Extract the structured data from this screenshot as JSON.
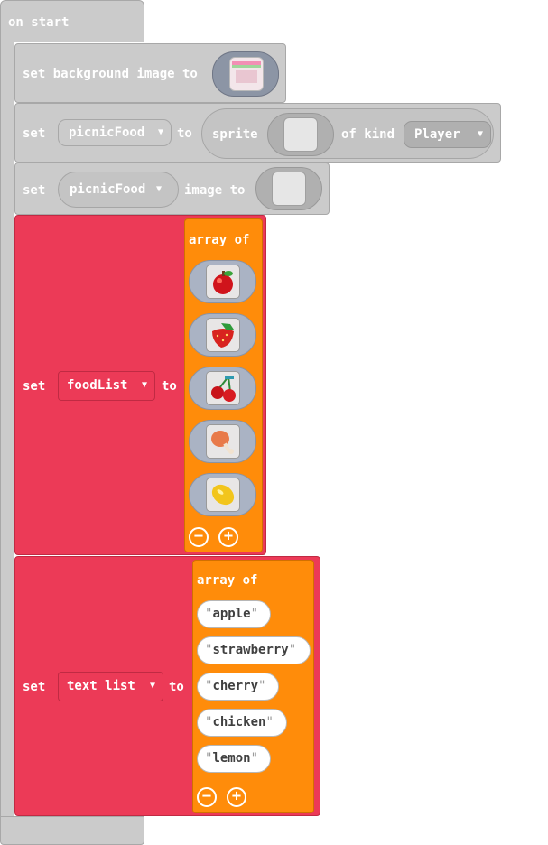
{
  "event": {
    "label": "on start"
  },
  "set_background": {
    "label": "set background image to"
  },
  "set_sprite": {
    "set": "set",
    "variable": "picnicFood",
    "to": "to",
    "sprite": "sprite",
    "of_kind": "of kind",
    "kind": "Player"
  },
  "set_image": {
    "set": "set",
    "variable": "picnicFood",
    "image_to": "image to"
  },
  "food_list": {
    "set": "set",
    "variable": "foodList",
    "to": "to",
    "array_of": "array of",
    "items": [
      {
        "icon": "apple-icon"
      },
      {
        "icon": "strawberry-icon"
      },
      {
        "icon": "cherry-icon"
      },
      {
        "icon": "chicken-icon"
      },
      {
        "icon": "lemon-icon"
      }
    ]
  },
  "text_list": {
    "set": "set",
    "variable": "text list",
    "to": "to",
    "array_of": "array of",
    "items": [
      "apple",
      "strawberry",
      "cherry",
      "chicken",
      "lemon"
    ]
  },
  "controls": {
    "remove": "−",
    "add": "+"
  },
  "colors": {
    "gray_block": "#cbcbcb",
    "variable_red": "#ec3a57",
    "array_orange": "#ff8c0a",
    "image_slot": "#aab3c4"
  }
}
